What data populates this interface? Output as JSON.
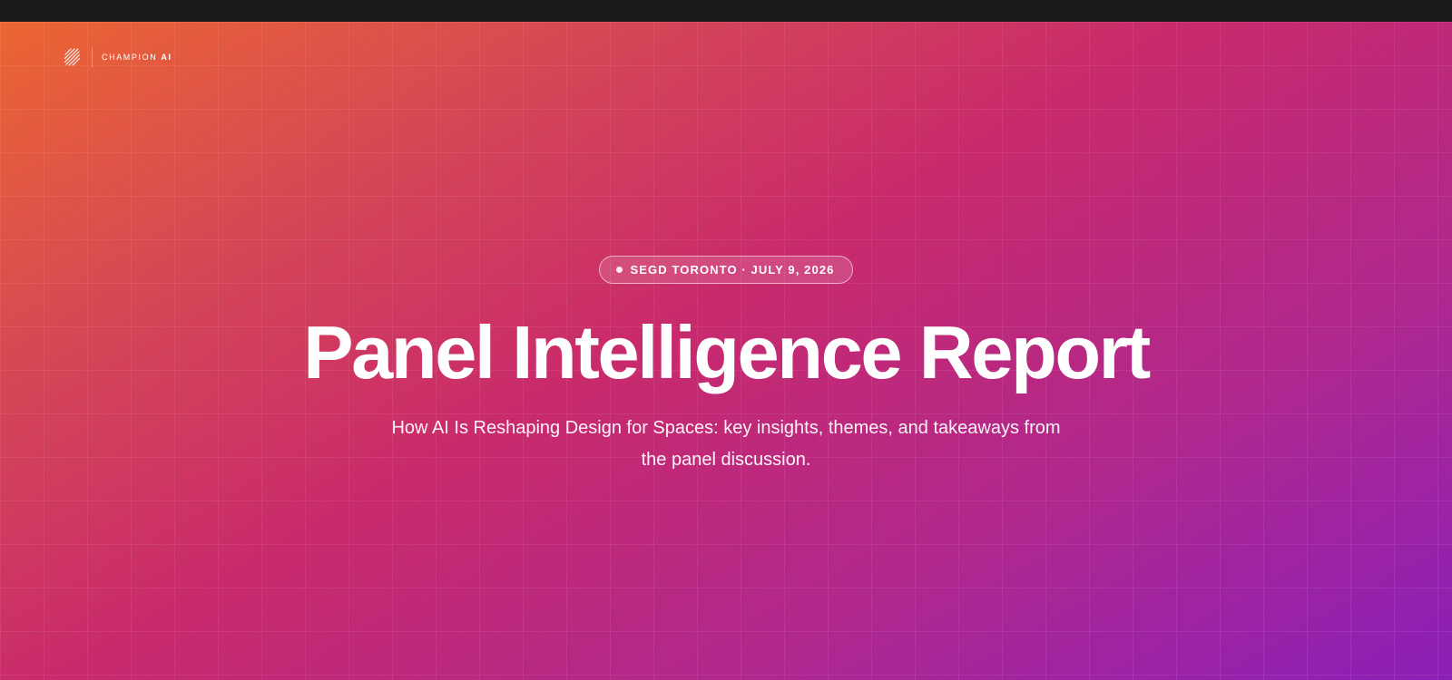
{
  "brand": {
    "logo_icon": "champion-ai-logo-icon",
    "name_prefix": "CHAMPION",
    "name_suffix": "AI"
  },
  "hero": {
    "badge": {
      "dot_icon": "dot-icon",
      "text": "SEGD TORONTO · JULY 9, 2026"
    },
    "title": "Panel Intelligence Report",
    "subtitle": "How AI Is Reshaping Design for Spaces: key insights, themes, and takeaways from the panel discussion."
  },
  "colors": {
    "gradient_start": "#ec6632",
    "gradient_mid": "#c92a6b",
    "gradient_end": "#8b1fb8",
    "topbar": "#1b1b1b",
    "text": "#ffffff"
  }
}
